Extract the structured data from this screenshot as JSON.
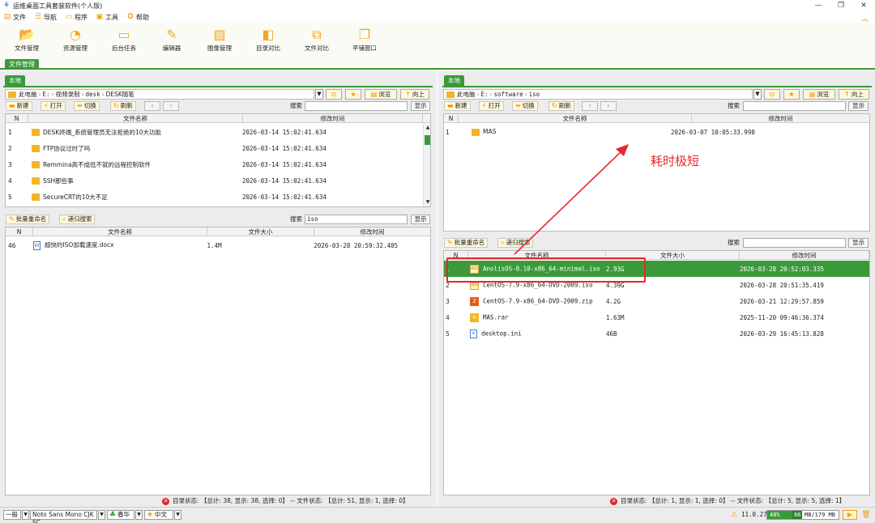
{
  "window": {
    "title": "运维桌面工具套装软件(个人版)",
    "min": "—",
    "restore": "❐",
    "close": "✕"
  },
  "menu": [
    {
      "label": "文件",
      "icon": "file-icon"
    },
    {
      "label": "导航",
      "icon": "list-icon"
    },
    {
      "label": "程序",
      "icon": "program-icon"
    },
    {
      "label": "工具",
      "icon": "toolbox-icon"
    },
    {
      "label": "帮助",
      "icon": "help-icon"
    }
  ],
  "toolbar": [
    {
      "label": "文件管理",
      "icon": "folder-open-icon"
    },
    {
      "label": "资源管理",
      "icon": "resource-icon"
    },
    {
      "label": "后台任务",
      "icon": "monitor-icon"
    },
    {
      "label": "编辑器",
      "icon": "edit-icon"
    },
    {
      "label": "图像管理",
      "icon": "image-icon"
    },
    {
      "label": "目录对比",
      "icon": "dir-compare-icon"
    },
    {
      "label": "文件对比",
      "icon": "file-compare-icon"
    },
    {
      "label": "平铺窗口",
      "icon": "tile-window-icon"
    }
  ],
  "main_tab": "文件管理",
  "left": {
    "tab": "本地",
    "path": [
      "此电脑",
      "E:",
      "视频录制",
      "desk",
      "DESK随笔"
    ],
    "browse": "浏览",
    "up": "向上",
    "new": "新建",
    "open": "打开",
    "switch": "切换",
    "refresh": "刷新",
    "search_label": "搜索",
    "search_value": "",
    "show": "显示",
    "columns": [
      "N",
      "文件名称",
      "修改时间"
    ],
    "rows": [
      {
        "n": "1",
        "name": "DESK终端_系统管理员无法拒绝的10大功能",
        "time": "2026-03-14 15:02:41.634"
      },
      {
        "n": "2",
        "name": "FTP协议过时了吗",
        "time": "2026-03-14 15:02:41.634"
      },
      {
        "n": "3",
        "name": "Remmina高不成低不就的远程控制软件",
        "time": "2026-03-14 15:02:41.634"
      },
      {
        "n": "4",
        "name": "SSH那些事",
        "time": "2026-03-14 15:02:41.634"
      },
      {
        "n": "5",
        "name": "SecureCRT的10大不足",
        "time": "2026-03-14 15:02:41.634"
      }
    ],
    "search_panel": {
      "rename": "批量重命名",
      "recursive": "递归搜索",
      "search_label": "搜索",
      "search_value": "iso",
      "show": "显示",
      "columns": [
        "N",
        "文件名称",
        "文件大小",
        "修改时间"
      ],
      "rows": [
        {
          "n": "46",
          "name": "超快的ISO加载速度.docx",
          "size": "1.4M",
          "time": "2026-03-28 20:59:32.405"
        }
      ]
    },
    "status": "目录状态: 【总计: 38, 显示: 38, 选择: 0】 -- 文件状态: 【总计: 51, 显示: 1, 选择: 0】"
  },
  "right": {
    "tab": "本地",
    "path": [
      "此电脑",
      "E:",
      "software",
      "iso"
    ],
    "browse": "浏览",
    "up": "向上",
    "new": "新建",
    "open": "打开",
    "switch": "切换",
    "refresh": "刷新",
    "search_label": "搜索",
    "search_value": "",
    "show": "显示",
    "columns": [
      "N",
      "文件名称",
      "修改时间"
    ],
    "rows": [
      {
        "n": "1",
        "name": "MAS",
        "time": "2026-03-07 10:05:33.998"
      }
    ],
    "search_panel": {
      "rename": "批量重命名",
      "recursive": "递归搜索",
      "search_label": "搜索",
      "search_value": "",
      "show": "显示",
      "columns": [
        "N",
        "文件名称",
        "文件大小",
        "修改时间"
      ],
      "rows": [
        {
          "n": "1",
          "name": "AnolisOS-8.10-x86_64-minimal.iso",
          "size": "2.93G",
          "time": "2026-03-28 20:52:03.335",
          "icon": "iso",
          "selected": true
        },
        {
          "n": "2",
          "name": "CentOS-7.9-x86_64-DVD-2009.iso",
          "size": "4.39G",
          "time": "2026-03-28 20:51:35.419",
          "icon": "iso"
        },
        {
          "n": "3",
          "name": "CentOS-7.9-x86_64-DVD-2009.zip",
          "size": "4.2G",
          "time": "2026-03-21 12:29:57.859",
          "icon": "zip"
        },
        {
          "n": "4",
          "name": "MAS.rar",
          "size": "1.63M",
          "time": "2025-11-20 09:46:36.374",
          "icon": "rar"
        },
        {
          "n": "5",
          "name": "desktop.ini",
          "size": "46B",
          "time": "2026-03-29 16:45:13.828",
          "icon": "ini"
        }
      ]
    },
    "status": "目录状态: 【总计: 1, 显示: 1, 选择: 0】 -- 文件状态: 【总计: 5, 显示: 5, 选择: 1】"
  },
  "annotation": {
    "text": "耗时极短",
    "color": "#e8262b"
  },
  "bottom": {
    "mode": "一般",
    "font": "Noto Sans Mono CJK SC",
    "theme": "春华",
    "lang": "中文",
    "version": "11.0.27",
    "memory_percent": "48%",
    "memory_used": "86",
    "memory_text": "MB/179 MB"
  },
  "colors": {
    "accent": "#3a9a3a",
    "icon_orange": "#f0a820",
    "annotation_red": "#e8262b"
  }
}
